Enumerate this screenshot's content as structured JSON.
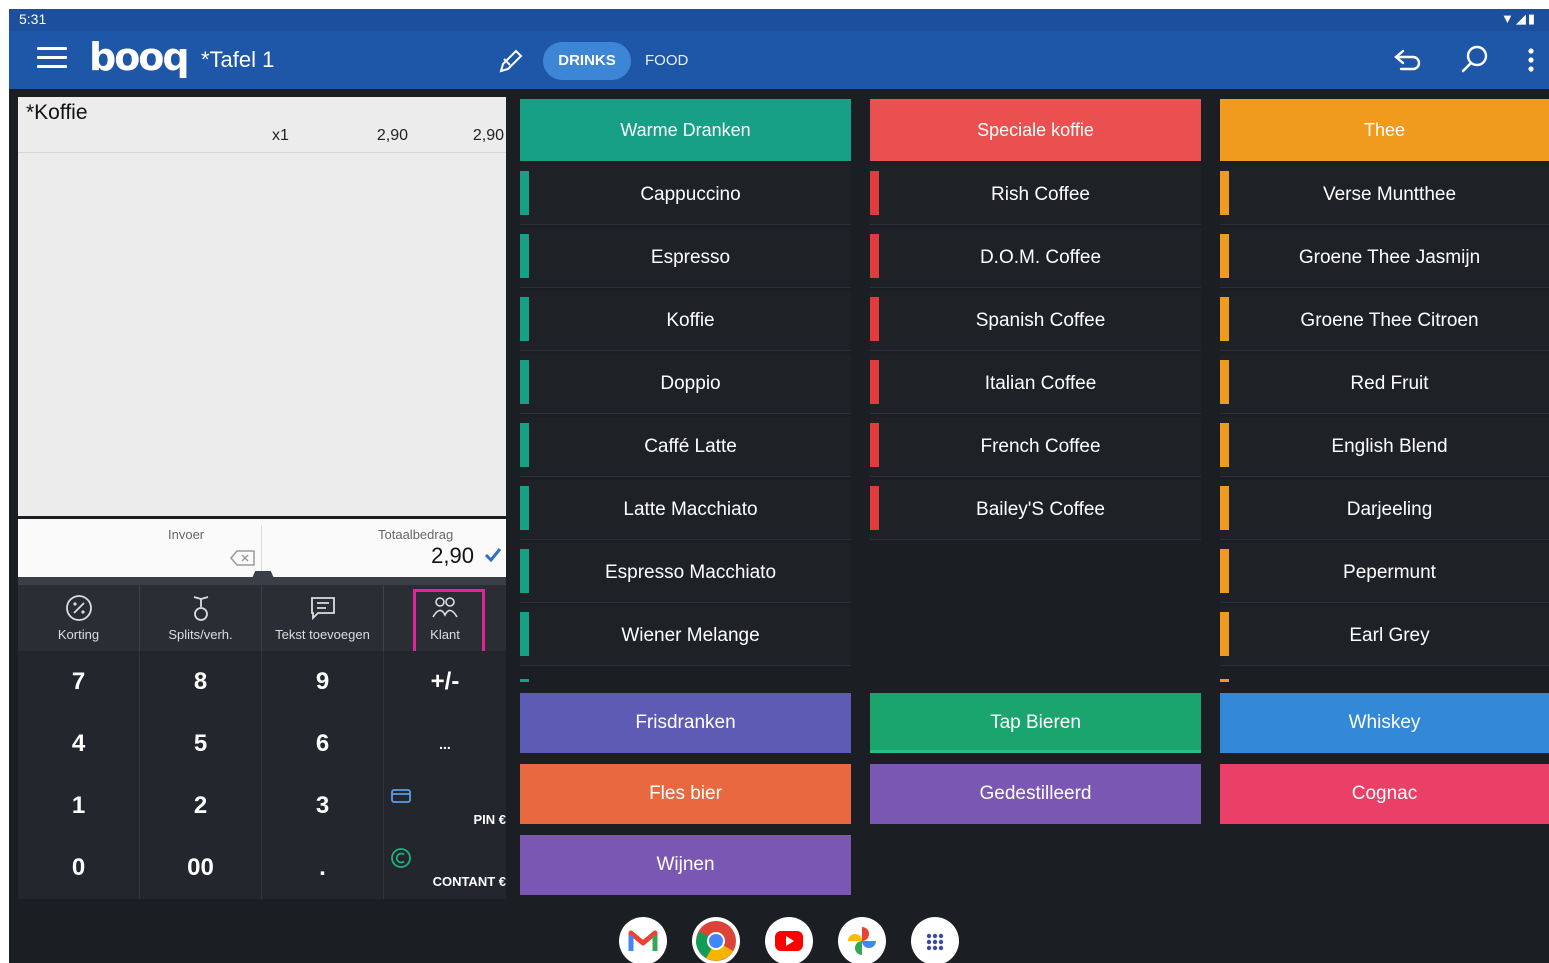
{
  "status_bar": {
    "time": "5:31",
    "icons": "▼◢▮"
  },
  "app_bar": {
    "logo": "booq",
    "table_name": "*Tafel 1",
    "tabs": [
      {
        "label": "DRINKS",
        "active": true
      },
      {
        "label": "FOOD",
        "active": false
      }
    ],
    "icons": [
      "menu-icon",
      "edit-icon",
      "back-icon",
      "search-icon",
      "more-icon"
    ]
  },
  "order": {
    "items": [
      {
        "name": "*Koffie",
        "qty": "x1",
        "unit_price": "2,90",
        "line_total": "2,90"
      }
    ]
  },
  "entry": {
    "input_label": "Invoer",
    "total_label": "Totaalbedrag",
    "total_value": "2,90"
  },
  "actions": [
    {
      "label": "Korting",
      "icon": "discount-icon"
    },
    {
      "label": "Splits/verh.",
      "icon": "split-icon"
    },
    {
      "label": "Tekst toevoegen",
      "icon": "comment-icon"
    },
    {
      "label": "Klant",
      "icon": "customer-icon"
    }
  ],
  "keypad": {
    "keys": [
      "7",
      "8",
      "9",
      "+/-",
      "4",
      "5",
      "6",
      "...",
      "1",
      "2",
      "3",
      "0",
      "00",
      "."
    ],
    "pin_label": "PIN €",
    "cash_label": "CONTANT €"
  },
  "colors": {
    "warme": "#17a085",
    "speciaal": "#ea5050",
    "thee": "#f09a1e",
    "frisdranken": "#5d5bb4",
    "tap_bieren": "#1aa56f",
    "whiskey": "#3488d8",
    "fles_bier": "#e8683f",
    "gedestilleerd": "#7b57b4",
    "cognac": "#ea3f66",
    "wijnen": "#7b57b4"
  },
  "categories": [
    {
      "header": "Warme Dranken",
      "items": [
        "Cappuccino",
        "Espresso",
        "Koffie",
        "Doppio",
        "Caffé Latte",
        "Latte Macchiato",
        "Espresso Macchiato",
        "Wiener Melange"
      ]
    },
    {
      "header": "Speciale koffie",
      "items": [
        "Rish Coffee",
        "D.O.M. Coffee",
        "Spanish Coffee",
        "Italian Coffee",
        "French Coffee",
        "Bailey'S Coffee"
      ]
    },
    {
      "header": "Thee",
      "items": [
        "Verse Muntthee",
        "Groene Thee Jasmijn",
        "Groene Thee Citroen",
        "Red Fruit",
        "English Blend",
        "Darjeeling",
        "Pepermunt",
        "Earl Grey"
      ]
    }
  ],
  "other_categories": [
    "Frisdranken",
    "Tap Bieren",
    "Whiskey",
    "Fles bier",
    "Gedestilleerd",
    "Cognac",
    "Wijnen"
  ],
  "dock": [
    "gmail-icon",
    "chrome-icon",
    "youtube-icon",
    "photos-icon",
    "apps-icon"
  ]
}
